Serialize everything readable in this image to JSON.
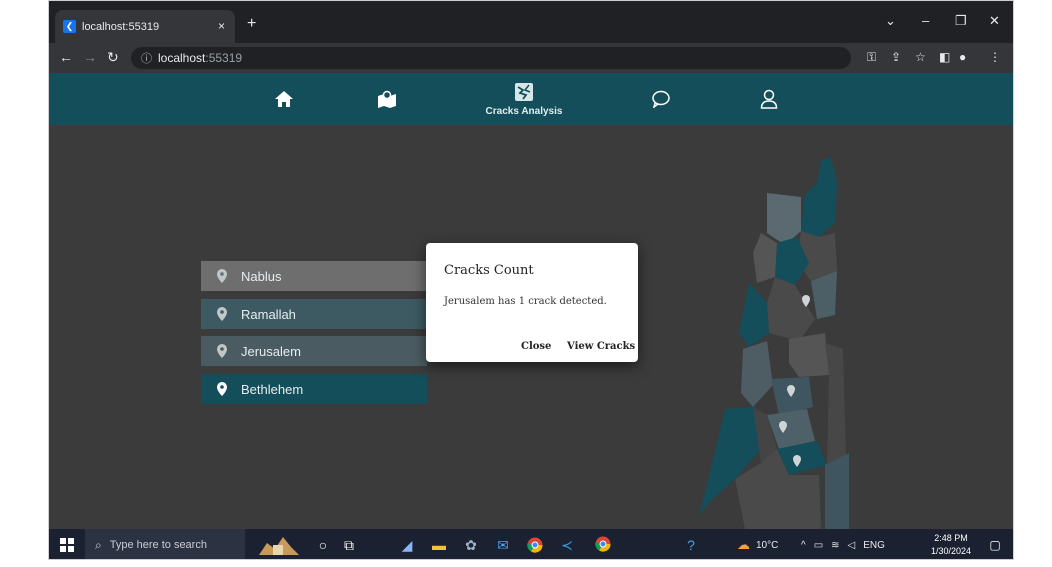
{
  "browser": {
    "tab_title": "localhost:55319",
    "tab_close": "×",
    "new_tab": "+",
    "url_host": "localhost",
    "url_port": ":55319",
    "win_min": "–",
    "win_restore": "❐",
    "win_close": "✕",
    "tab_list": "⌄"
  },
  "nav": {
    "items": [
      {
        "icon": "home-icon"
      },
      {
        "icon": "map-icon"
      },
      {
        "icon": "cracks-analysis-icon",
        "label": "Cracks Analysis"
      },
      {
        "icon": "chat-icon"
      },
      {
        "icon": "user-icon"
      }
    ],
    "accent": "#134e5a"
  },
  "cities": [
    {
      "name": "Nablus",
      "color": "#6e6e6e"
    },
    {
      "name": "Ramallah",
      "color": "#3d5a63"
    },
    {
      "name": "Jerusalem",
      "color": "#4a5c62"
    },
    {
      "name": "Bethlehem",
      "color": "#134e5a"
    }
  ],
  "dialog": {
    "title": "Cracks Count",
    "message": "Jerusalem has 1 crack detected.",
    "close_label": "Close",
    "view_label": "View Cracks"
  },
  "taskbar": {
    "search_placeholder": "Type here to search",
    "weather": "10°C",
    "lang": "ENG",
    "time": "2:48 PM",
    "date": "1/30/2024"
  }
}
